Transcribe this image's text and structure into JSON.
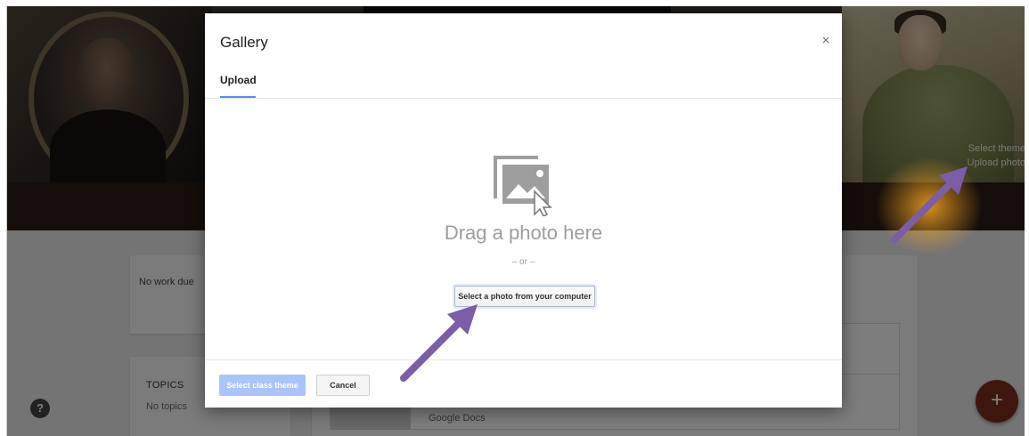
{
  "background": {
    "theme_links": [
      "Select theme",
      "Upload photo"
    ],
    "stream_card": {
      "text": "No work due"
    },
    "topics_card": {
      "title": "TOPICS",
      "value": "No topics"
    },
    "list_item": {
      "label": "Google Docs"
    },
    "help_icon": "?",
    "fab_icon": "+"
  },
  "dialog": {
    "title": "Gallery",
    "close_icon": "×",
    "tab": "Upload",
    "drop_title": "Drag a photo here",
    "or_text": "– or –",
    "select_button": "Select a photo from your computer",
    "primary_button": "Select class theme",
    "cancel_button": "Cancel"
  },
  "colors": {
    "arrow": "#7b5ea7",
    "glow": "#f5a623",
    "accent": "#4d90fe",
    "disabled_primary": "#a9c4f6"
  },
  "icons": {
    "drop_icon": "image-upload-icon",
    "close_icon": "close-icon",
    "help_icon": "help-icon",
    "fab_icon": "add-icon"
  }
}
